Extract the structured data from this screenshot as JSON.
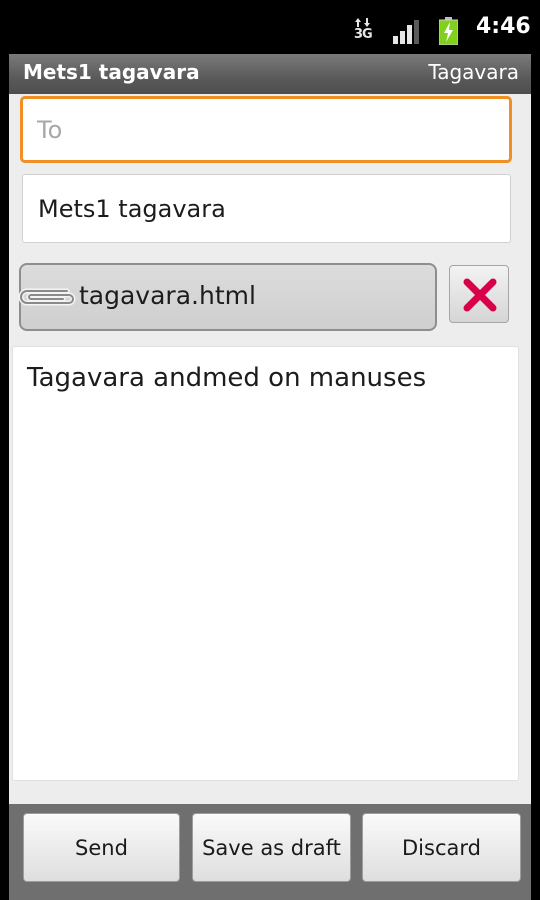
{
  "status_bar": {
    "network": "3G",
    "clock": "4:46"
  },
  "header": {
    "title": "Mets1 tagavara",
    "account": "Tagavara"
  },
  "compose": {
    "to_placeholder": "To",
    "to_value": "",
    "subject_value": "Mets1 tagavara",
    "attachment_name": "tagavara.html",
    "body_text": "Tagavara andmed on manuses"
  },
  "buttons": {
    "send": "Send",
    "save_draft": "Save as draft",
    "discard": "Discard"
  },
  "colors": {
    "focus_border": "#f08f23",
    "remove_icon": "#d8004a",
    "battery_fill": "#7fd11b"
  },
  "icons": {
    "attachment": "paperclip-icon",
    "remove": "close-x-icon",
    "battery": "battery-charging-icon",
    "signal": "signal-bars-icon",
    "data": "data-arrows-icon"
  }
}
